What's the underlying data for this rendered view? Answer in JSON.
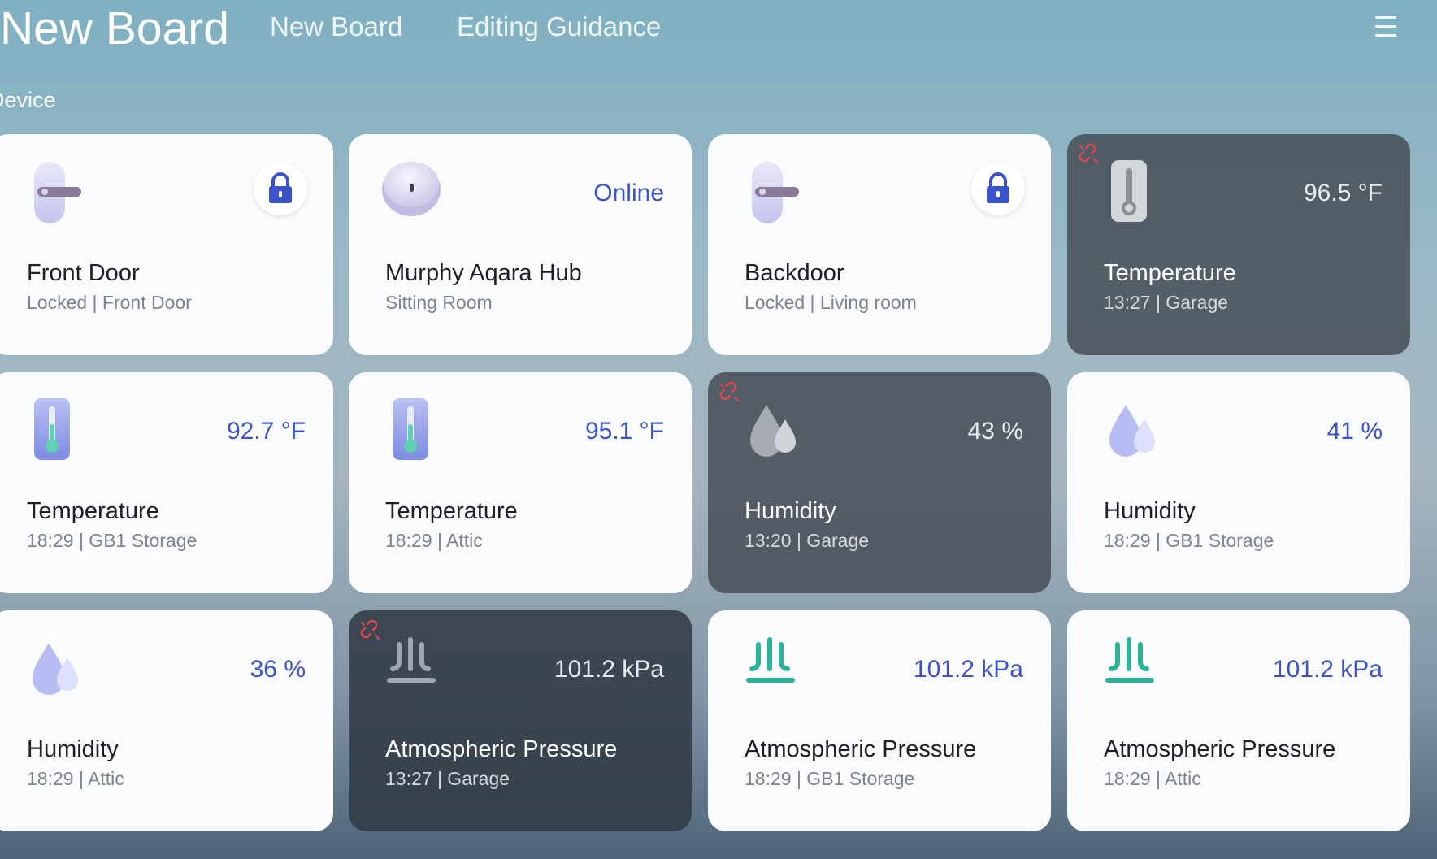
{
  "header": {
    "title": "New Board",
    "tabs": [
      {
        "label": "New Board"
      },
      {
        "label": "Editing Guidance"
      }
    ],
    "menu_icon": "hamburger-menu-icon"
  },
  "section": {
    "label": "Device"
  },
  "colors": {
    "accent": "#3d53c9",
    "offline_badge": "#e0474c",
    "pressure_icon": "#2cb39a",
    "dark_card": "#464e56"
  },
  "devices": [
    {
      "name": "Front Door",
      "subtitle": "Locked | Front Door",
      "icon": "door-lock-icon",
      "status_icon": "lock-icon",
      "offline": false
    },
    {
      "name": "Murphy Aqara Hub",
      "subtitle": "Sitting Room",
      "value": "Online",
      "icon": "hub-icon",
      "offline": false
    },
    {
      "name": "Backdoor",
      "subtitle": "Locked | Living room",
      "icon": "door-lock-icon",
      "status_icon": "lock-icon",
      "offline": false
    },
    {
      "name": "Temperature",
      "subtitle": "13:27 | Garage",
      "value": "96.5 °F",
      "icon": "thermometer-icon",
      "offline": true
    },
    {
      "name": "Temperature",
      "subtitle": "18:29 | GB1 Storage",
      "value": "92.7 °F",
      "icon": "thermometer-icon",
      "offline": false
    },
    {
      "name": "Temperature",
      "subtitle": "18:29 | Attic",
      "value": "95.1 °F",
      "icon": "thermometer-icon",
      "offline": false
    },
    {
      "name": "Humidity",
      "subtitle": "13:20 | Garage",
      "value": "43 %",
      "icon": "humidity-drops-icon",
      "offline": true
    },
    {
      "name": "Humidity",
      "subtitle": "18:29 | GB1 Storage",
      "value": "41 %",
      "icon": "humidity-drops-icon",
      "offline": false
    },
    {
      "name": "Humidity",
      "subtitle": "18:29 | Attic",
      "value": "36 %",
      "icon": "humidity-drops-icon",
      "offline": false
    },
    {
      "name": "Atmospheric Pressure",
      "subtitle": "13:27 | Garage",
      "value": "101.2 kPa",
      "icon": "pressure-icon",
      "offline": true
    },
    {
      "name": "Atmospheric Pressure",
      "subtitle": "18:29 | GB1 Storage",
      "value": "101.2 kPa",
      "icon": "pressure-icon",
      "offline": false
    },
    {
      "name": "Atmospheric Pressure",
      "subtitle": "18:29 | Attic",
      "value": "101.2 kPa",
      "icon": "pressure-icon",
      "offline": false
    }
  ]
}
